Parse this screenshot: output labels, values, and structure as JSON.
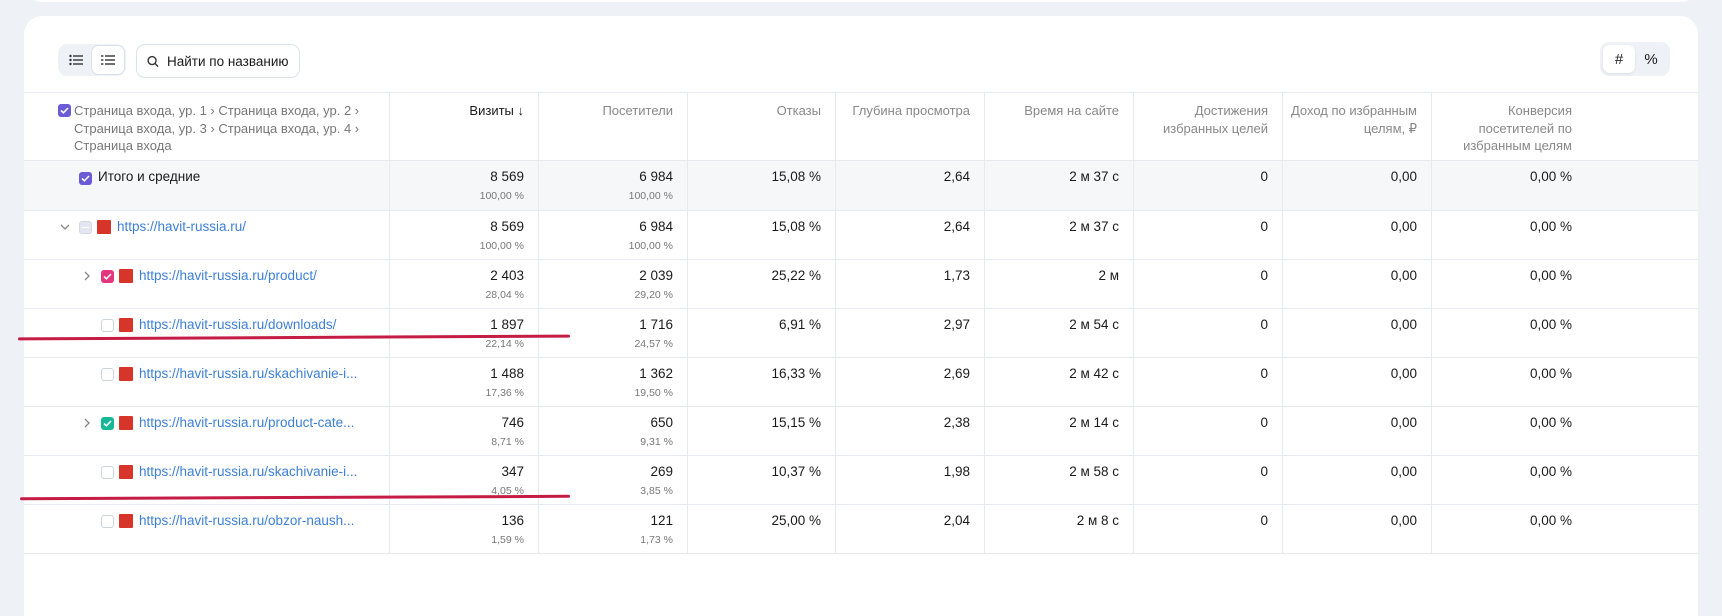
{
  "toolbar": {
    "search_placeholder": "Найти по названию",
    "mode_count_label": "#",
    "mode_percent_label": "%"
  },
  "header": {
    "dimension": "Страница входа, ур. 1 › Страница входа, ур. 2 › Страница входа, ур. 3 › Страница входа, ур. 4 › Страница входа",
    "columns": [
      "Визиты ↓",
      "Посетители",
      "Отказы",
      "Глубина просмотра",
      "Время на сайте",
      "Достижения избранных целей",
      "Доход по избранным целям, ₽",
      "Конверсия посетителей по избранным целям"
    ]
  },
  "total": {
    "label": "Итого и средние",
    "visits": "8 569",
    "visits_pct": "100,00 %",
    "visitors": "6 984",
    "visitors_pct": "100,00 %",
    "bounce": "15,08 %",
    "depth": "2,64",
    "time": "2 м 37 с",
    "goals": "0",
    "revenue": "0,00",
    "conversion": "0,00 %"
  },
  "rows": [
    {
      "url": "https://havit-russia.ru/",
      "visits": "8 569",
      "visits_pct": "100,00 %",
      "visitors": "6 984",
      "visitors_pct": "100,00 %",
      "bounce": "15,08 %",
      "depth": "2,64",
      "time": "2 м 37 с",
      "goals": "0",
      "revenue": "0,00",
      "conversion": "0,00 %"
    },
    {
      "url": "https://havit-russia.ru/product/",
      "visits": "2 403",
      "visits_pct": "28,04 %",
      "visitors": "2 039",
      "visitors_pct": "29,20 %",
      "bounce": "25,22 %",
      "depth": "1,73",
      "time": "2 м",
      "goals": "0",
      "revenue": "0,00",
      "conversion": "0,00 %"
    },
    {
      "url": "https://havit-russia.ru/downloads/",
      "visits": "1 897",
      "visits_pct": "22,14 %",
      "visitors": "1 716",
      "visitors_pct": "24,57 %",
      "bounce": "6,91 %",
      "depth": "2,97",
      "time": "2 м 54 с",
      "goals": "0",
      "revenue": "0,00",
      "conversion": "0,00 %"
    },
    {
      "url": "https://havit-russia.ru/skachivanie-i...",
      "visits": "1 488",
      "visits_pct": "17,36 %",
      "visitors": "1 362",
      "visitors_pct": "19,50 %",
      "bounce": "16,33 %",
      "depth": "2,69",
      "time": "2 м 42 с",
      "goals": "0",
      "revenue": "0,00",
      "conversion": "0,00 %"
    },
    {
      "url": "https://havit-russia.ru/product-cate...",
      "visits": "746",
      "visits_pct": "8,71 %",
      "visitors": "650",
      "visitors_pct": "9,31 %",
      "bounce": "15,15 %",
      "depth": "2,38",
      "time": "2 м 14 с",
      "goals": "0",
      "revenue": "0,00",
      "conversion": "0,00 %"
    },
    {
      "url": "https://havit-russia.ru/skachivanie-i...",
      "visits": "347",
      "visits_pct": "4,05 %",
      "visitors": "269",
      "visitors_pct": "3,85 %",
      "bounce": "10,37 %",
      "depth": "1,98",
      "time": "2 м 58 с",
      "goals": "0",
      "revenue": "0,00",
      "conversion": "0,00 %"
    },
    {
      "url": "https://havit-russia.ru/obzor-naush...",
      "visits": "136",
      "visits_pct": "1,59 %",
      "visitors": "121",
      "visitors_pct": "1,73 %",
      "bounce": "25,00 %",
      "depth": "2,04",
      "time": "2 м 8 с",
      "goals": "0",
      "revenue": "0,00",
      "conversion": "0,00 %"
    }
  ],
  "colors": {
    "accent_purple": "#6b5bd6",
    "accent_pink": "#e6357f",
    "accent_teal": "#17b897",
    "link": "#3d7fd6",
    "annotation": "#c41c45"
  }
}
